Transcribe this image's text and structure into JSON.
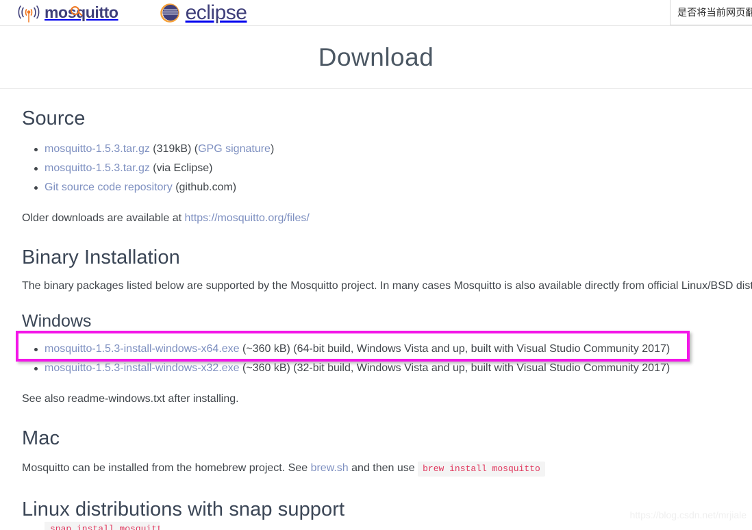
{
  "header": {
    "mosquitto_logo_text": "mosquitto",
    "eclipse_logo_text": "eclipse",
    "translate_prompt": "是否将当前网页翻"
  },
  "page": {
    "title": "Download"
  },
  "source": {
    "heading": "Source",
    "items": [
      {
        "link": "mosquitto-1.5.3.tar.gz",
        "after": " (319kB) (",
        "link2": "GPG signature",
        "after2": ")"
      },
      {
        "link": "mosquitto-1.5.3.tar.gz",
        "after": " (via Eclipse)",
        "link2": "",
        "after2": ""
      },
      {
        "link": "Git source code repository",
        "after": " (github.com)",
        "link2": "",
        "after2": ""
      }
    ],
    "older_prefix": "Older downloads are available at ",
    "older_link": "https://mosquitto.org/files/"
  },
  "binary": {
    "heading": "Binary Installation",
    "paragraph": "The binary packages listed below are supported by the Mosquitto project. In many cases Mosquitto is also available directly from official Linux/BSD dist"
  },
  "windows": {
    "heading": "Windows",
    "items": [
      {
        "link": "mosquitto-1.5.3-install-windows-x64.exe",
        "after": " (~360 kB) (64-bit build, Windows Vista and up, built with Visual Studio Community 2017)"
      },
      {
        "link": "mosquitto-1.5.3-install-windows-x32.exe",
        "after": " (~360 kB) (32-bit build, Windows Vista and up, built with Visual Studio Community 2017)"
      }
    ],
    "note": "See also readme-windows.txt after installing."
  },
  "mac": {
    "heading": "Mac",
    "prefix": "Mosquitto can be installed from the homebrew project. See ",
    "link": "brew.sh",
    "middle": " and then use ",
    "code": "brew install mosquitto"
  },
  "snap": {
    "heading": "Linux distributions with snap support",
    "code_partial": "snap install mosquitto"
  },
  "annotation": {
    "highlight_color": "#f316e8"
  },
  "watermark": {
    "text": "https://blog.csdn.net/mrjiale"
  }
}
